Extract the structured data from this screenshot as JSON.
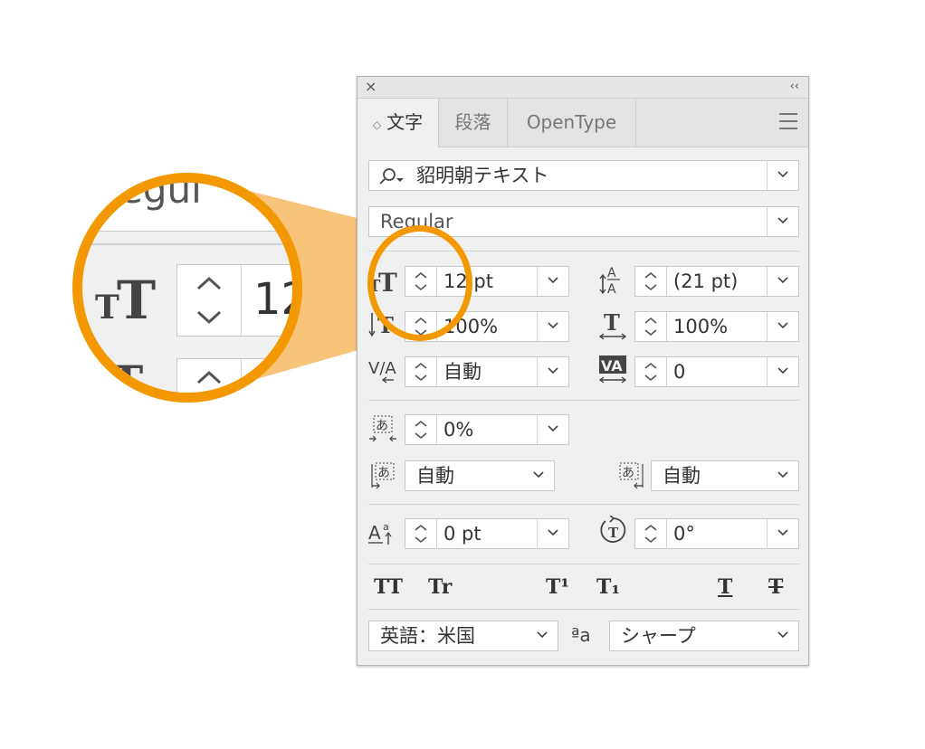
{
  "panel": {
    "close_glyph": "×",
    "collapse_glyph": "‹‹",
    "tabs": [
      {
        "label": "文字",
        "active": true
      },
      {
        "label": "段落",
        "active": false
      },
      {
        "label": "OpenType",
        "active": false
      }
    ],
    "tab_indicator": "◇",
    "font_family": "貂明朝テキスト",
    "font_style": "Regular",
    "font_size": "12 pt",
    "leading": "(21 pt)",
    "vertical_scale": "100%",
    "horizontal_scale": "100%",
    "kerning": "自動",
    "tracking": "0",
    "tsume": "0%",
    "aki_before": "自動",
    "aki_after": "自動",
    "baseline_shift": "0 pt",
    "rotation": "0°",
    "caps": {
      "all_caps": "TT",
      "small_caps": "Tr",
      "superscript": "T¹",
      "subscript": "T₁",
      "underline": "T",
      "strike": "T"
    },
    "language": "英語：米国",
    "aa_label": "ªa",
    "antialias": "シャープ"
  },
  "zoom": {
    "style_fragment": "egul",
    "size_fragment": "12"
  },
  "colors": {
    "accent": "#f39800",
    "accent_light": "#f8c47a"
  }
}
